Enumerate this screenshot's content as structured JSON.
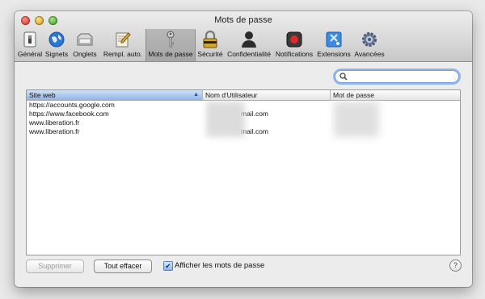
{
  "window": {
    "title": "Mots de passe"
  },
  "toolbar": {
    "items": [
      {
        "label": "Général",
        "icon": "switch-icon"
      },
      {
        "label": "Signets",
        "icon": "globe-icon"
      },
      {
        "label": "Onglets",
        "icon": "tabs-icon"
      },
      {
        "label": "Rempl. auto.",
        "icon": "pencil-form-icon"
      },
      {
        "label": "Mots de passe",
        "icon": "key-icon",
        "selected": true
      },
      {
        "label": "Sécurité",
        "icon": "lock-icon"
      },
      {
        "label": "Confidentialité",
        "icon": "person-silhouette-icon"
      },
      {
        "label": "Notifications",
        "icon": "record-icon"
      },
      {
        "label": "Extensions",
        "icon": "puzzle-icon"
      },
      {
        "label": "Avancées",
        "icon": "gear-icon"
      }
    ]
  },
  "search": {
    "placeholder": "",
    "value": ""
  },
  "table": {
    "columns": [
      "Site web",
      "Nom d'Utilisateur",
      "Mot de passe"
    ],
    "sorted_column": "Site web",
    "rows": [
      {
        "site": "https://accounts.google.com",
        "user": "",
        "password": ""
      },
      {
        "site": "https://www.facebook.com",
        "user": "mail.com",
        "password": ""
      },
      {
        "site": "www.liberation.fr",
        "user": "",
        "password": ""
      },
      {
        "site": "www.liberation.fr",
        "user": "mail.com",
        "password": ""
      }
    ]
  },
  "buttons": {
    "delete": "Supprimer",
    "clear_all": "Tout effacer"
  },
  "show_passwords": {
    "label": "Afficher les mots de passe",
    "checked": true
  },
  "help": "?"
}
